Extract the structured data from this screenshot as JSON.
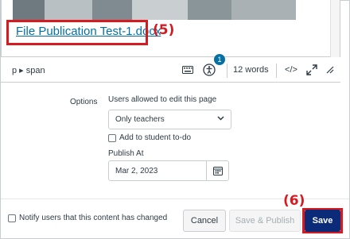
{
  "editor": {
    "doc_link": "File Publication Test-1.docx",
    "callout_5": "(5)"
  },
  "statusbar": {
    "path": "p ▸ span",
    "a11y_count": "1",
    "word_count": "12 words",
    "html_toggle": "</>",
    "fullscreen_icon": "expand-icon",
    "keyboard_icon": "keyboard-icon",
    "accessibility_icon": "accessibility-icon"
  },
  "options": {
    "section_label": "Options",
    "edit_label": "Users allowed to edit this page",
    "edit_value": "Only teachers",
    "todo_label": "Add to student to-do",
    "publish_label": "Publish At",
    "publish_date": "Mar 2, 2023"
  },
  "footer": {
    "notify_label": "Notify users that this content has changed",
    "cancel_label": "Cancel",
    "save_publish_label": "Save & Publish",
    "save_label": "Save",
    "callout_6": "(6)"
  },
  "colors": {
    "link": "#0770a3",
    "primary": "#0b2a77",
    "callout": "#d71920"
  }
}
